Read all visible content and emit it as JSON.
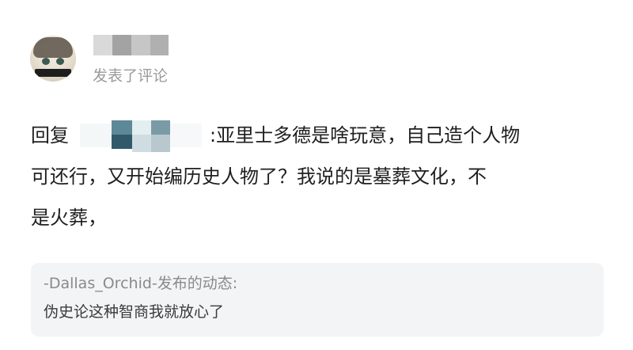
{
  "comment": {
    "action_text": "发表了评论",
    "reply_prefix": "回复",
    "reply_lines": [
      ":亚里士多德是啥玩意，自己造个人物",
      "可还行，又开始编历史人物了？我说的是墓葬文化，不",
      "是火葬，"
    ]
  },
  "quote": {
    "source": "-Dallas_Orchid-发布的动态:",
    "body": "伪史论这种智商我就放心了"
  },
  "colors": {
    "text_primary": "#1f1f1f",
    "text_secondary": "#9a9a9a",
    "quote_background": "#f3f4f6"
  }
}
